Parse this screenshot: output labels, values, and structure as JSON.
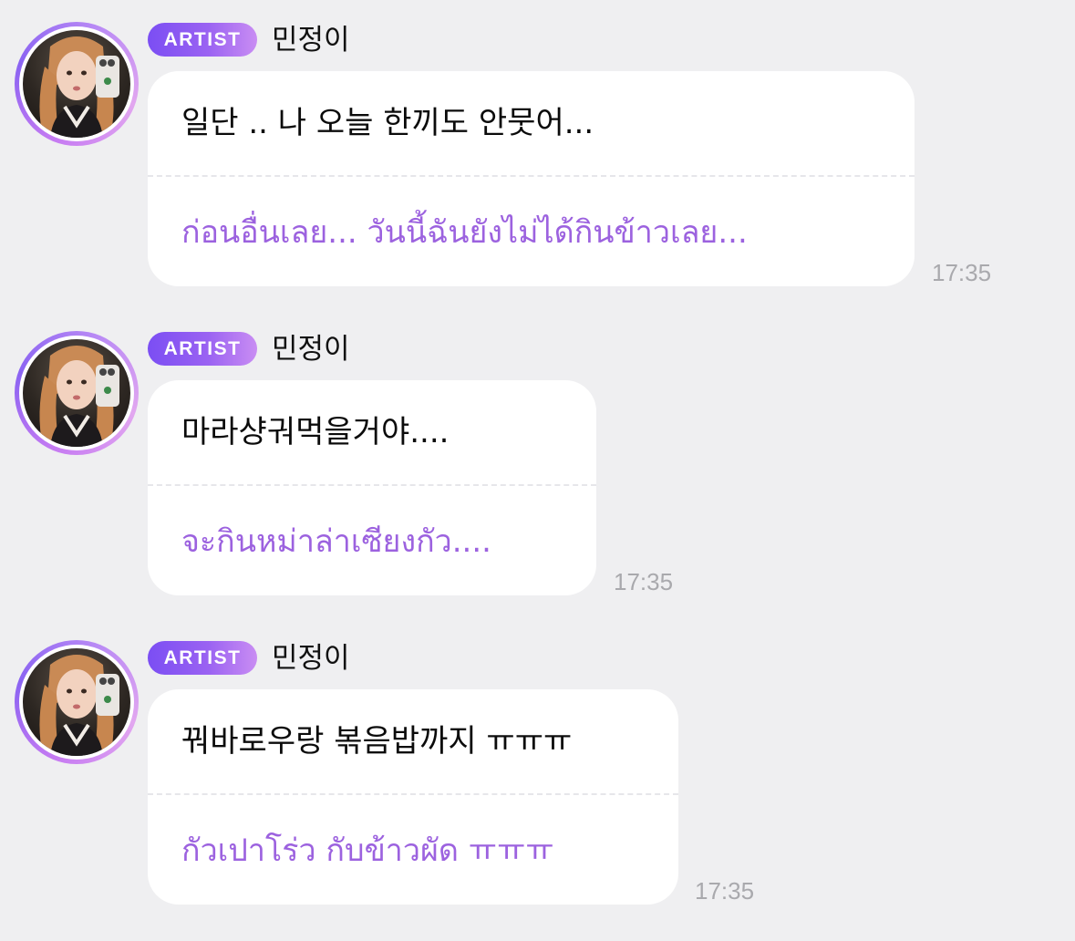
{
  "messages": [
    {
      "badge": "ARTIST",
      "sender": "민정이",
      "original": "일단 .. 나 오늘 한끼도 안뭇어...",
      "translation": "ก่อนอื่นเลย... วันนี้ฉันยังไม่ได้กินข้าวเลย...",
      "time": "17:35"
    },
    {
      "badge": "ARTIST",
      "sender": "민정이",
      "original": "마라샹궈먹을거야....",
      "translation": "จะกินหม่าล่าเซียงกัว....",
      "time": "17:35"
    },
    {
      "badge": "ARTIST",
      "sender": "민정이",
      "original": "꿔바로우랑 볶음밥까지 ㅠㅠㅠ",
      "translation": "กัวเปาโร่ว กับข้าวผัด ㅠㅠㅠ",
      "time": "17:35"
    }
  ],
  "colors": {
    "background": "#efeff1",
    "bubble": "#ffffff",
    "translation_text": "#9c62df",
    "badge_gradient_start": "#7b4ef3",
    "badge_gradient_end": "#c98df3",
    "time_text": "#a9a9ad"
  }
}
